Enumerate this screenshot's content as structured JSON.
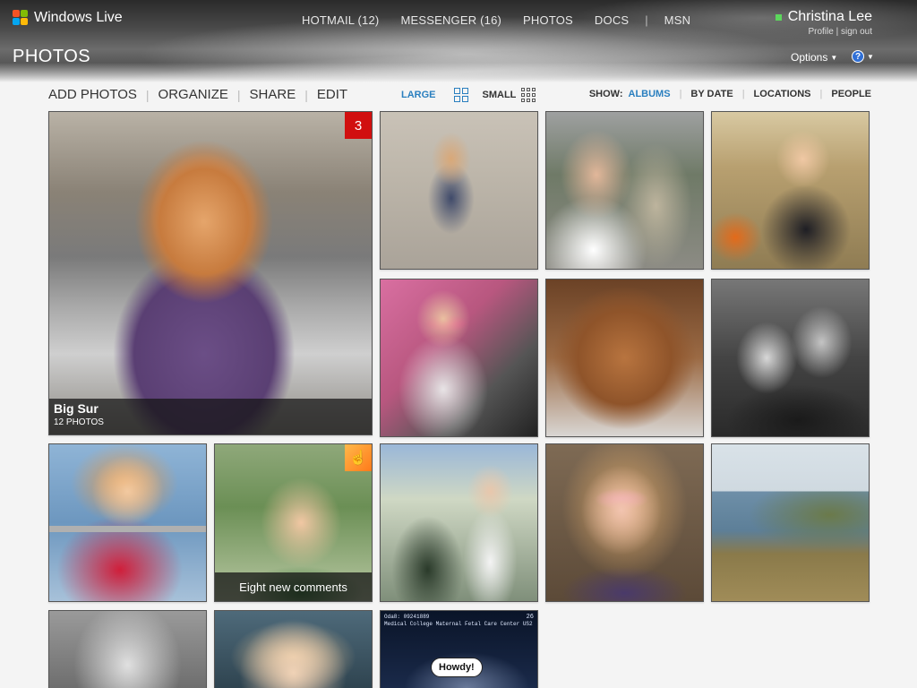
{
  "header": {
    "brand": "Windows Live",
    "nav": [
      {
        "label": "HOTMAIL (12)"
      },
      {
        "label": "MESSENGER (16)"
      },
      {
        "label": "PHOTOS"
      },
      {
        "label": "DOCS"
      },
      {
        "label": "MSN"
      }
    ],
    "user_name": "Christina Lee",
    "profile_link": "Profile",
    "signout_link": "sign out",
    "page_title": "PHOTOS",
    "options_label": "Options",
    "help_label": "?"
  },
  "toolbar": {
    "actions": [
      "ADD PHOTOS",
      "ORGANIZE",
      "SHARE",
      "EDIT"
    ],
    "view_large": "LARGE",
    "view_small": "SMALL",
    "show_label": "SHOW:",
    "show_options": [
      "ALBUMS",
      "BY DATE",
      "LOCATIONS",
      "PEOPLE"
    ],
    "show_active": "ALBUMS"
  },
  "featured": {
    "title": "Big Sur",
    "count": "12 PHOTOS",
    "badge": "3"
  },
  "hover_tile": {
    "comment": "Eight new comments"
  },
  "ultrasound": {
    "bubble": "Howdy!",
    "line1": "Oda8: 09241889",
    "line2": "Medical College Maternal Fetal Care Center US2",
    "corner": "26"
  },
  "colors": {
    "accent": "#2a7fbf",
    "badge_red": "#d10f0f",
    "presence": "#5cd75c"
  }
}
